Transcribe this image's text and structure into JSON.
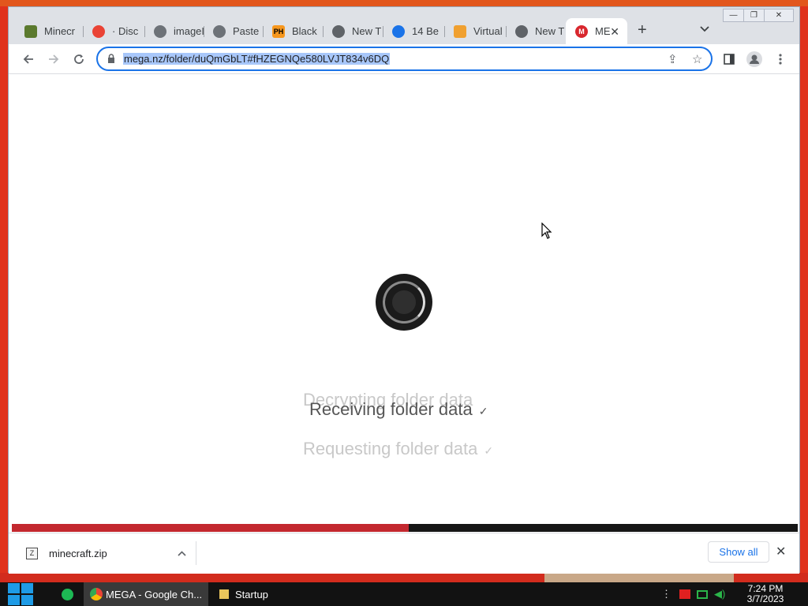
{
  "window": {
    "controls": {
      "minimize": "—",
      "restore": "❐",
      "close": "✕"
    }
  },
  "tabs": [
    {
      "title": "Minecr",
      "icon": "minecraft-block-icon",
      "color": "#5b7a2e"
    },
    {
      "title": "· Disc",
      "icon": "chrome-g-icon",
      "color": "#ea4335"
    },
    {
      "title": "imageI",
      "icon": "globe-icon",
      "color": "#5f6368"
    },
    {
      "title": "Paste",
      "icon": "globe-icon",
      "color": "#5f6368"
    },
    {
      "title": "Black",
      "icon": "ph-logo-icon",
      "color": "#f7971d"
    },
    {
      "title": "New T",
      "icon": "chrome-icon",
      "color": "#5f6368"
    },
    {
      "title": "14 Be",
      "icon": "blue-circle-icon",
      "color": "#1a73e8"
    },
    {
      "title": "Virtual",
      "icon": "fan-icon",
      "color": "#f0a030"
    },
    {
      "title": "New T",
      "icon": "chrome-icon",
      "color": "#5f6368"
    },
    {
      "title": "ME",
      "icon": "mega-logo-icon",
      "color": "#d9272e",
      "active": true
    }
  ],
  "toolbar": {
    "new_tab": "+",
    "tab_search": "⌄",
    "url": "mega.nz/folder/duQmGbLT#fHZEGNQe580LVJT834v6DQ"
  },
  "page": {
    "steps": [
      {
        "text": "Decrypting folder data",
        "color": "#c8c8c8"
      },
      {
        "text": "Receiving folder data",
        "color": "#555555",
        "check": "✓"
      },
      {
        "text": "Requesting folder data",
        "color": "#c8c8c8",
        "check": "✓"
      }
    ],
    "progress": 0.505,
    "progress_color": "#c3282f"
  },
  "downloads": {
    "file_name": "minecraft.zip",
    "show_all": "Show all"
  },
  "taskbar": {
    "items": [
      {
        "label": "MEGA - Google Ch...",
        "active": true
      },
      {
        "label": "Startup",
        "active": false
      }
    ],
    "time": "7:24 PM",
    "date": "3/7/2023"
  }
}
